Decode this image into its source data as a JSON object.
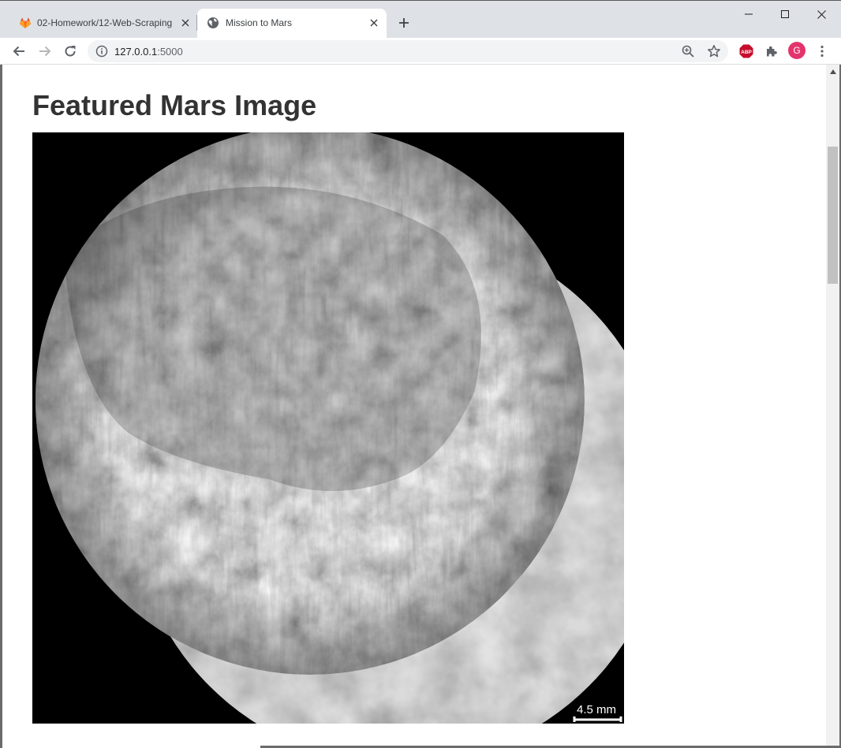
{
  "browser": {
    "tabs": [
      {
        "title": "02-Homework/12-Web-Scraping",
        "active": false,
        "favicon": "gitlab-icon"
      },
      {
        "title": "Mission to Mars",
        "active": true,
        "favicon": "globe-icon"
      }
    ],
    "new_tab_icon": "plus-icon",
    "window_controls": [
      "minimize-icon",
      "maximize-icon",
      "close-icon"
    ],
    "address_bar": {
      "host": "127.0.0.1",
      "port": ":5000",
      "site_info_icon": "info-icon"
    },
    "toolbar_icons": [
      "back-icon",
      "forward-icon",
      "reload-icon",
      "zoom-icon",
      "star-icon",
      "abp-icon",
      "extensions-icon",
      "menu-icon"
    ],
    "avatar_letter": "G",
    "colors": {
      "tabbar": "#dee1e6",
      "avatar": "#e4346d",
      "adblock": "#c70d2c"
    }
  },
  "page": {
    "heading": "Featured Mars Image",
    "image": {
      "scale_bar_label": "4.5 mm"
    }
  }
}
